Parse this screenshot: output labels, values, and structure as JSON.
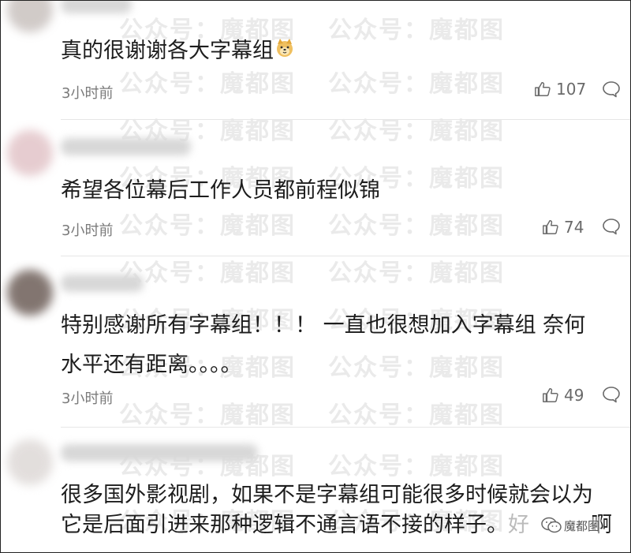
{
  "watermark": "公众号：魔都图",
  "comments": [
    {
      "text": "真的很谢谢各大字幕组",
      "emoji": "smiling-dog-emoji",
      "time": "3小时前",
      "likes": "107"
    },
    {
      "text": "希望各位幕后工作人员都前程似锦",
      "time": "3小时前",
      "likes": "74"
    },
    {
      "lines": [
        "特别感谢所有字幕组！！！ 一直也很想加入字幕组 奈何",
        "水平还有距离。。。。"
      ],
      "time": "3小时前",
      "likes": "49"
    },
    {
      "lines": [
        "很多国外影视剧，如果不是字幕组可能很多时候就会以为",
        "它是后面引进来那种逻辑不通言语不接的样子。"
      ],
      "tail_partial": "好",
      "tail_end": "啊"
    }
  ],
  "source_badge": {
    "label": "魔都图",
    "icon": "wechat-icon"
  },
  "colors": {
    "text": "#1d1d1d",
    "meta": "#7a7a7a",
    "watermark": "#eaeaea"
  }
}
